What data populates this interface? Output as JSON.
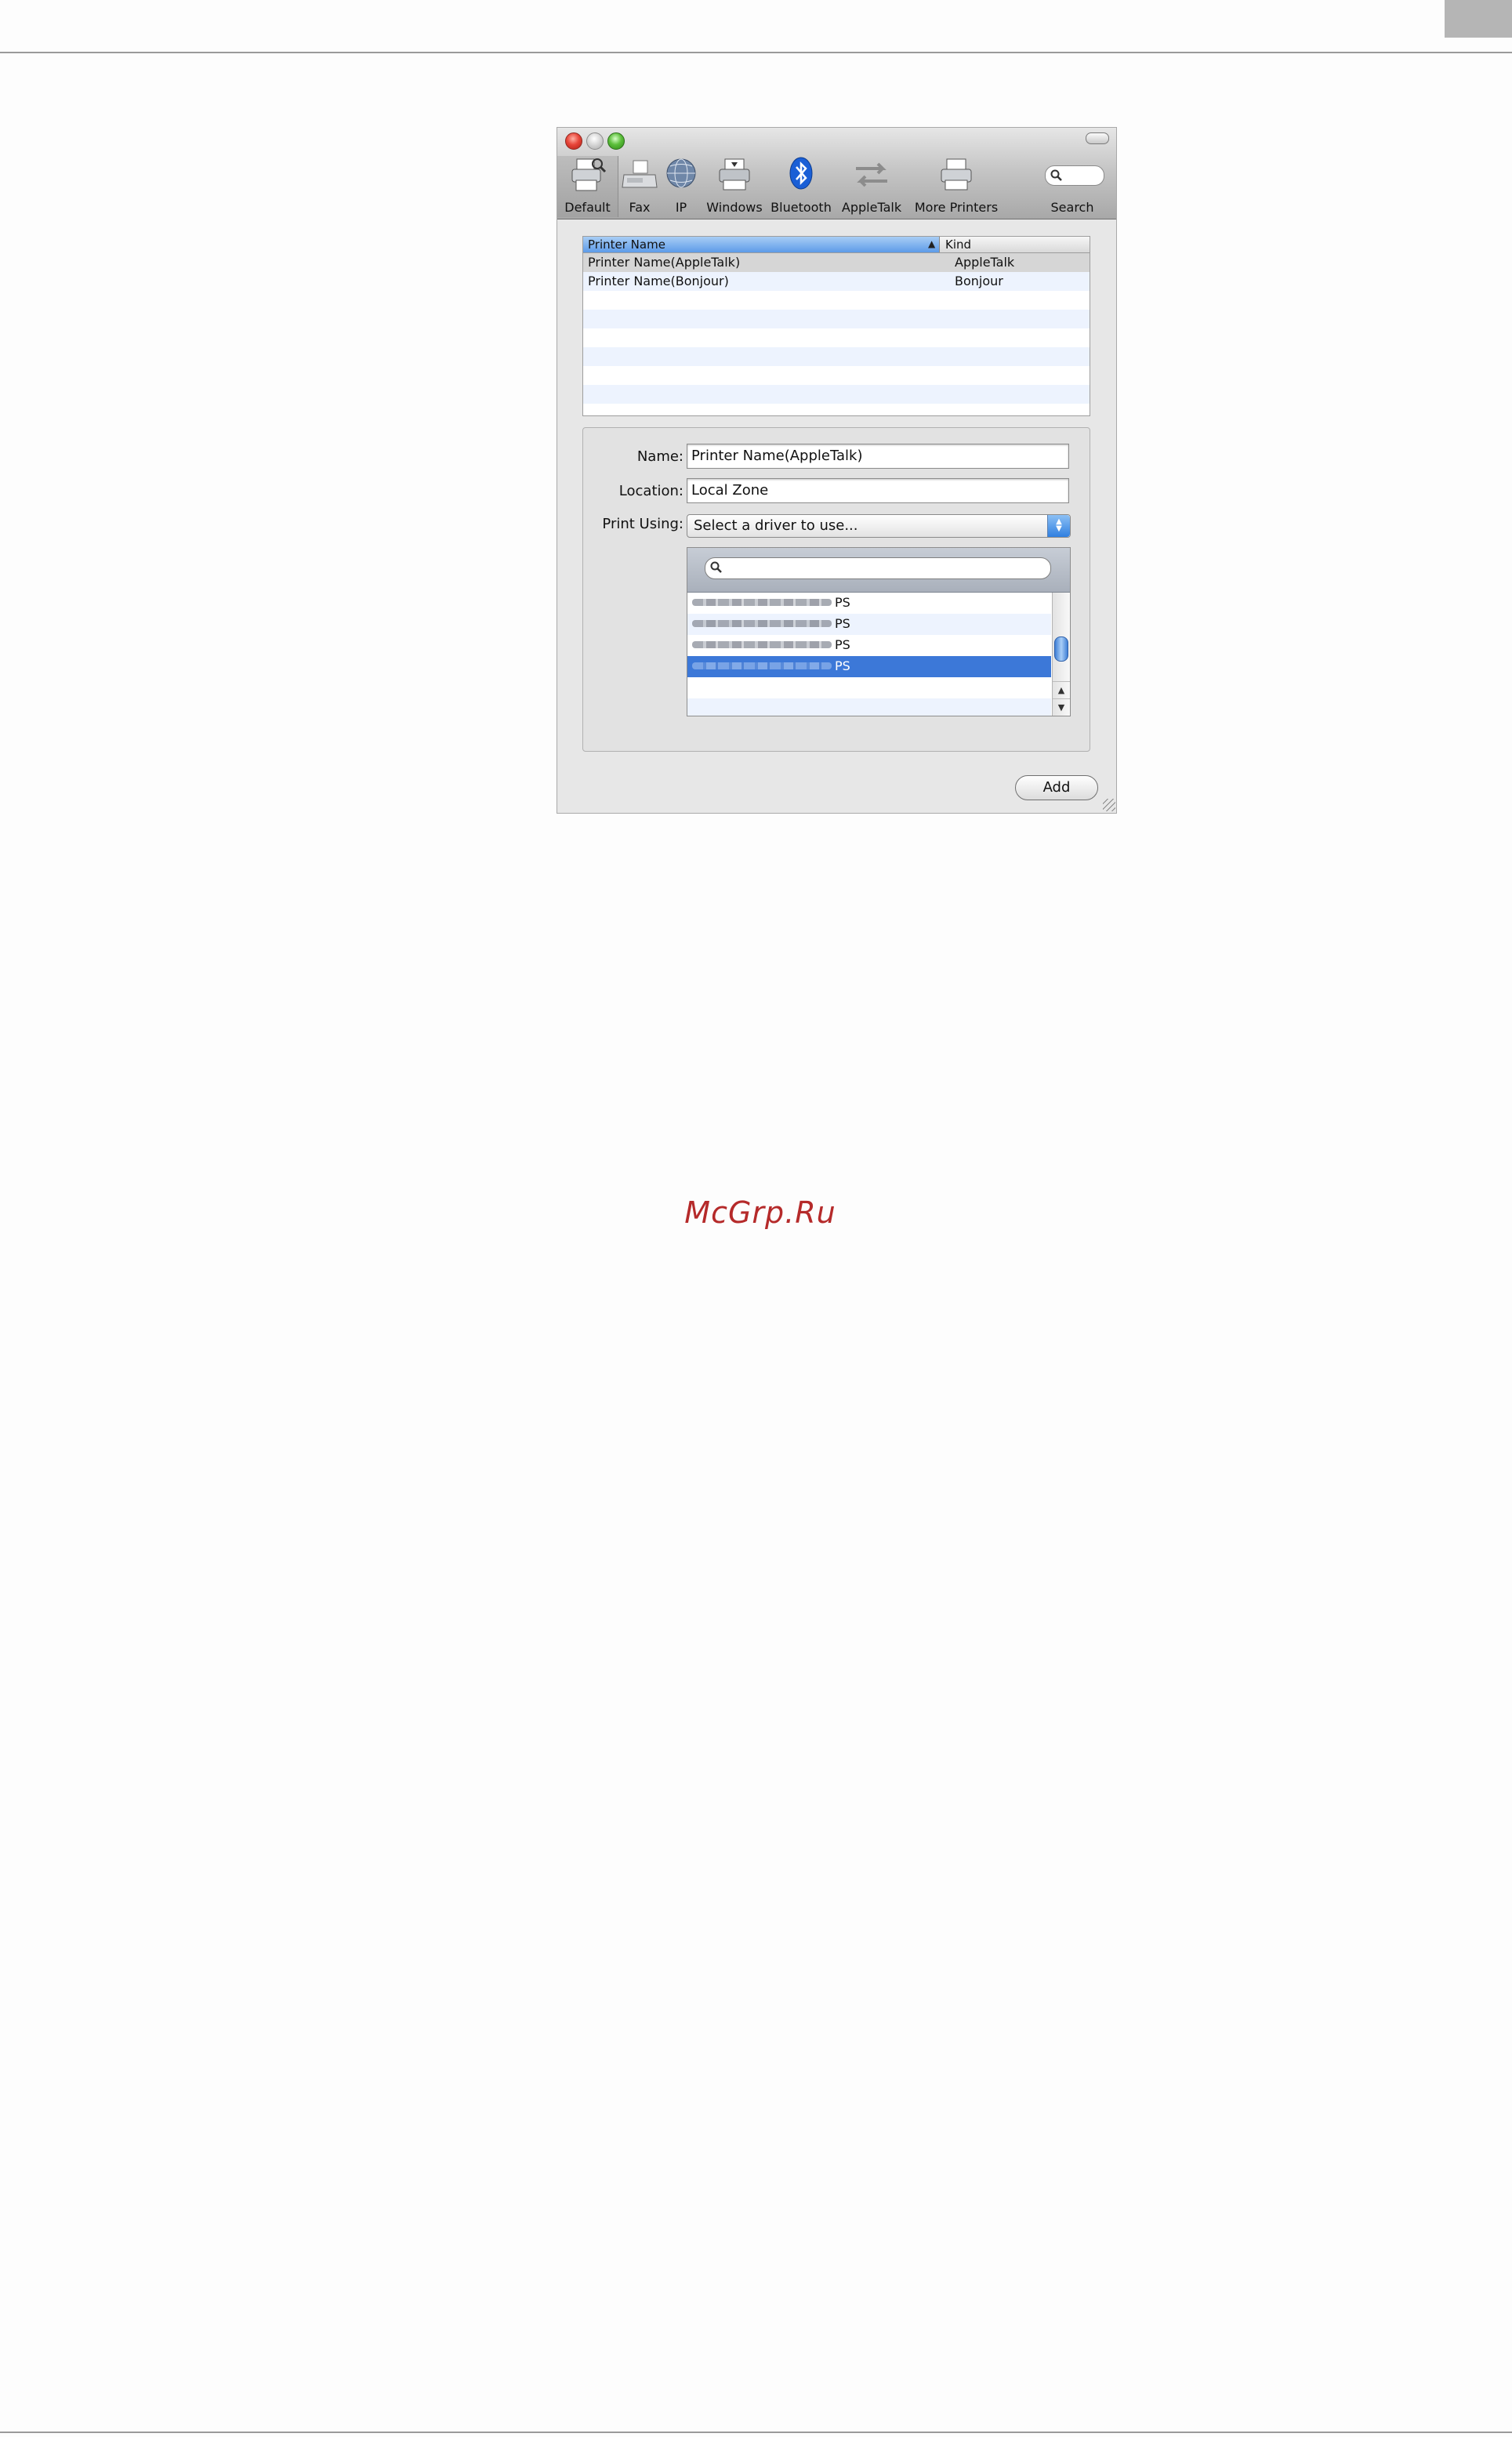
{
  "toolbar": {
    "items": [
      {
        "label": "Default",
        "icon": "printer-default-icon"
      },
      {
        "label": "Fax",
        "icon": "fax-icon"
      },
      {
        "label": "IP",
        "icon": "globe-icon"
      },
      {
        "label": "Windows",
        "icon": "windows-printer-icon"
      },
      {
        "label": "Bluetooth",
        "icon": "bluetooth-icon"
      },
      {
        "label": "AppleTalk",
        "icon": "appletalk-arrows-icon"
      },
      {
        "label": "More Printers",
        "icon": "printer-icon"
      },
      {
        "label": "Search",
        "icon": "search-icon"
      }
    ]
  },
  "printer_list": {
    "columns": [
      "Printer Name",
      "Kind"
    ],
    "rows": [
      {
        "name": "Printer Name(AppleTalk)",
        "kind": "AppleTalk"
      },
      {
        "name": "Printer Name(Bonjour)",
        "kind": "Bonjour"
      }
    ]
  },
  "details": {
    "name_label": "Name:",
    "name_value": "Printer Name(AppleTalk)",
    "location_label": "Location:",
    "location_value": "Local Zone",
    "print_using_label": "Print Using:",
    "print_using_value": "Select a driver to use..."
  },
  "drivers": {
    "items": [
      {
        "suffix": "PS",
        "selected": false
      },
      {
        "suffix": "PS",
        "selected": false
      },
      {
        "suffix": "PS",
        "selected": false
      },
      {
        "suffix": "PS",
        "selected": true
      }
    ]
  },
  "add_label": "Add",
  "watermark": "McGrp.Ru",
  "colors": {
    "selection": "#3c78d8",
    "header_blue": "#5d9be8",
    "stripe": "#edf3fe",
    "watermark": "#b52a2a"
  }
}
